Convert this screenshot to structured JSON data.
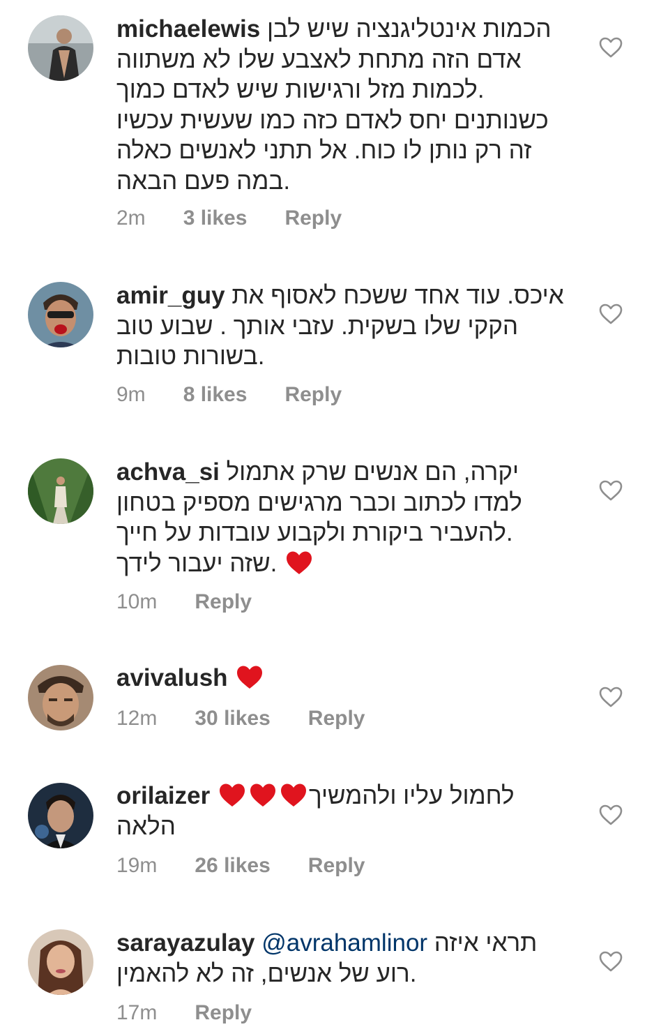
{
  "colors": {
    "username": "#262626",
    "meta": "#8e8e8e",
    "mention": "#003569",
    "heart_emoji": "#e0141e",
    "like_outline": "#8e8e8e"
  },
  "comments": [
    {
      "username": "michaelewis",
      "lines": [
        "הכמות אינטליגנציה שיש לבן",
        "אדם הזה מתחת לאצבע שלו לא משתווה",
        "לכמות מזל ורגישות שיש לאדם כמוך.",
        "כשנותנים יחס לאדם כזה כמו שעשית עכשיו",
        "זה רק נותן לו כוח. אל תתני לאנשים כאלה",
        "במה פעם הבאה."
      ],
      "time": "2m",
      "likes": "3 likes",
      "reply": "Reply",
      "like_icon": "heart-outline-icon"
    },
    {
      "username": "amir_guy",
      "lines": [
        "איכס. עוד אחד ששכח לאסוף את",
        "הקקי שלו בשקית. עזבי אותך . שבוע טוב",
        "בשורות טובות."
      ],
      "time": "9m",
      "likes": "8 likes",
      "reply": "Reply",
      "like_icon": "heart-outline-icon"
    },
    {
      "username": "achva_si",
      "lines": [
        "יקרה, הם אנשים שרק אתמול",
        "למדו לכתוב וכבר מרגישים מספיק בטחון",
        "להעביר ביקורת ולקבוע עובדות על חייך.",
        "שזה יעבור לידך."
      ],
      "time": "10m",
      "likes": "",
      "reply": "Reply",
      "like_icon": "heart-outline-icon"
    },
    {
      "username": "avivalush",
      "lines": [],
      "time": "12m",
      "likes": "30 likes",
      "reply": "Reply",
      "like_icon": "heart-outline-icon"
    },
    {
      "username": "orilaizer",
      "lines": [
        "לחמול עליו ולהמשיך",
        "הלאה"
      ],
      "time": "19m",
      "likes": "26 likes",
      "reply": "Reply",
      "like_icon": "heart-outline-icon"
    },
    {
      "username": "sarayazulay",
      "mention": "@avrahamlinor",
      "lines": [
        "תראי איזה",
        "רוע של אנשים, זה לא להאמין."
      ],
      "time": "17m",
      "likes": "",
      "reply": "Reply",
      "like_icon": "heart-outline-icon"
    }
  ]
}
